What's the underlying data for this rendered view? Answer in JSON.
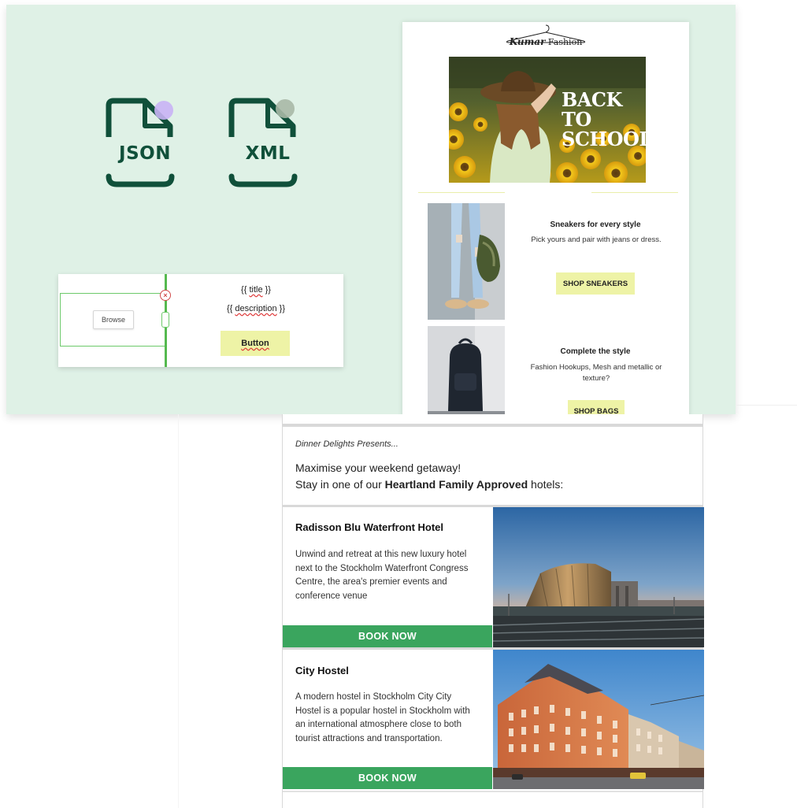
{
  "file_icons": [
    {
      "name": "json-file-icon",
      "label": "JSON",
      "accent": "#c9b3f5"
    },
    {
      "name": "xml-file-icon",
      "label": "XML",
      "accent": "#a8b8a6"
    }
  ],
  "colors": {
    "mint": "#dff1e6",
    "icon_green": "#10503a",
    "book_green": "#3aa55e",
    "pale_yellow": "#eef3a6"
  },
  "editor": {
    "browse_label": "Browse",
    "title_open": "{{ ",
    "title_token": "title",
    "title_close": " }}",
    "desc_open": "{{ ",
    "desc_token": "description",
    "desc_close": " }}",
    "button_label": "Button",
    "close_glyph": "×"
  },
  "fashion": {
    "logo_script": "Kumar",
    "logo_word": " Fashion",
    "hero_lines": [
      "BACK",
      "TO",
      "SCHOOL"
    ],
    "blocks": [
      {
        "title": "Sneakers for every style",
        "text": "Pick yours and pair with jeans or dress.",
        "button": "SHOP SNEAKERS"
      },
      {
        "title": "Complete the style",
        "text": "Fashion Hookups, Mesh and metallic or texture?",
        "button": "SHOP BAGS"
      }
    ]
  },
  "hotel": {
    "presents": "Dinner Delights Presents...",
    "intro_line1": "Maximise your weekend getaway!",
    "intro_line2_pre": "Stay in one of our ",
    "intro_line2_bold": "Heartland Family Approved",
    "intro_line2_post": " hotels:",
    "items": [
      {
        "name": "Radisson Blu Waterfront Hotel",
        "description": "Unwind and retreat at this new luxury hotel next to the Stockholm Waterfront Congress Centre, the area's premier events and conference venue",
        "button": "BOOK NOW"
      },
      {
        "name": "City Hostel",
        "description": "A modern hostel in Stockholm City City Hostel is a popular hostel in Stockholm with an international atmosphere close to both tourist attractions and transportation.",
        "button": "BOOK NOW"
      }
    ]
  }
}
